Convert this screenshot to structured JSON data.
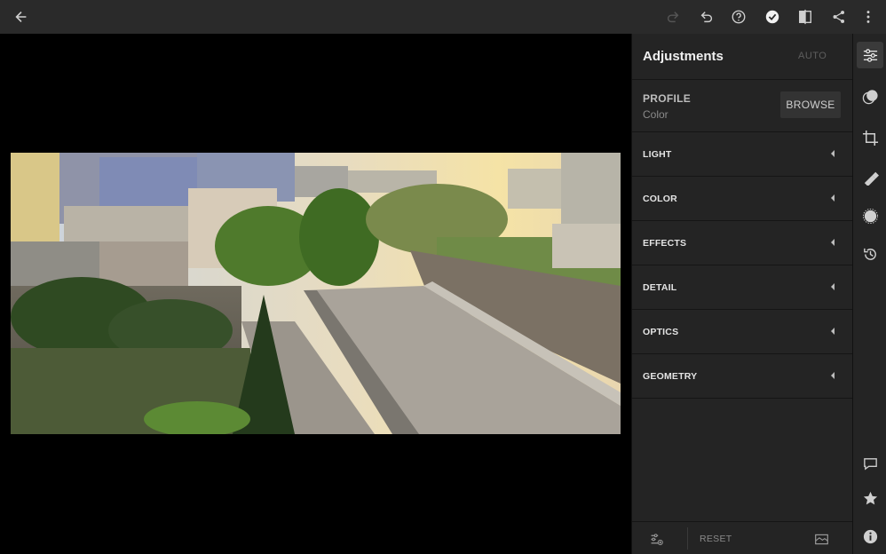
{
  "topbar": {
    "icons": [
      "back-arrow-icon",
      "redo-icon",
      "undo-icon",
      "help-icon",
      "done-check-icon",
      "compare-icon",
      "share-icon",
      "more-vertical-icon"
    ]
  },
  "panel": {
    "title": "Adjustments",
    "auto_label": "AUTO",
    "profile": {
      "label": "PROFILE",
      "value": "Color",
      "browse_label": "BROWSE"
    },
    "sections": [
      {
        "label": "LIGHT"
      },
      {
        "label": "COLOR"
      },
      {
        "label": "EFFECTS"
      },
      {
        "label": "DETAIL"
      },
      {
        "label": "OPTICS"
      },
      {
        "label": "GEOMETRY"
      }
    ],
    "footer": {
      "reset_label": "RESET"
    }
  },
  "toolrail": {
    "tools": [
      "adjustments-icon",
      "presets-icon",
      "crop-icon",
      "healing-icon",
      "masking-icon",
      "history-icon"
    ],
    "bottom": [
      "comment-icon",
      "star-icon",
      "info-icon"
    ]
  },
  "colors": {
    "topbar_bg": "#2a2a2a",
    "panel_bg": "#242424",
    "canvas_bg": "#000000",
    "accent_text": "#f0f0f0"
  }
}
